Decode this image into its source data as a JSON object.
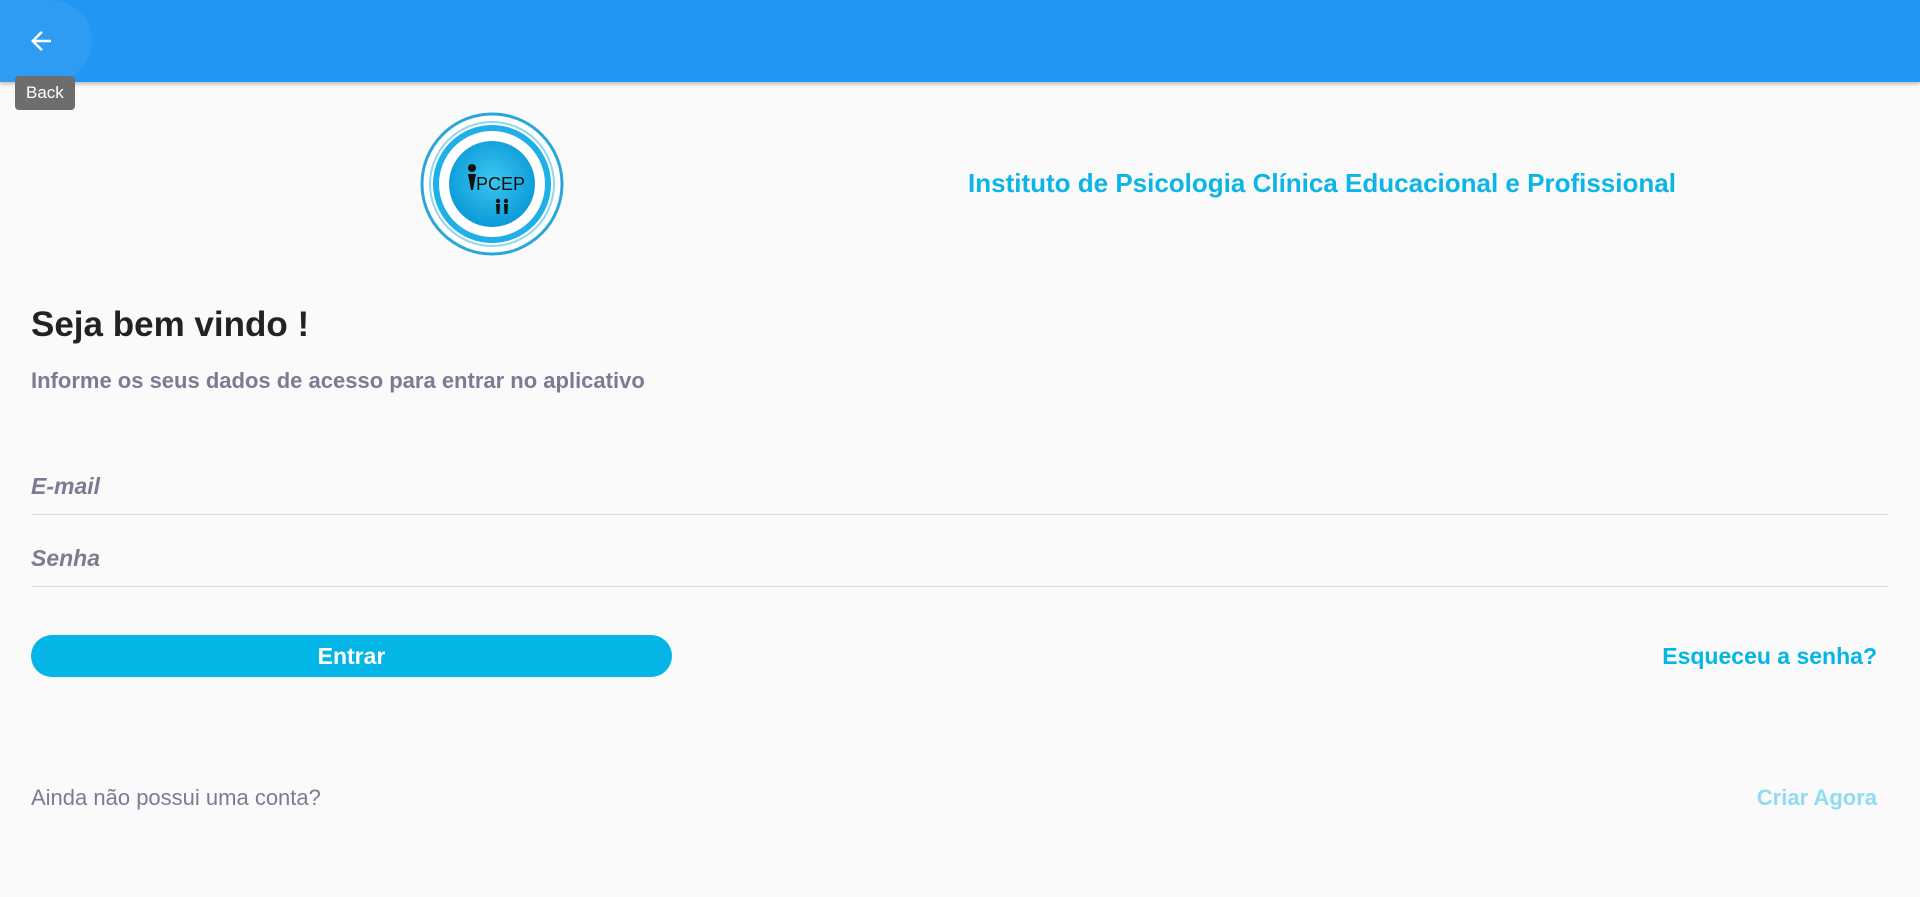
{
  "appbar": {
    "color": "#2196f3",
    "back_icon": "arrow-back-icon",
    "back_tooltip": "Back"
  },
  "header": {
    "logo_text": "PCEP",
    "logo_icon": "pcep-logo",
    "institute_name": "Instituto de Psicologia Clínica Educacional e Profissional",
    "accent_color": "#0bb5e6"
  },
  "login": {
    "welcome_title": "Seja bem vindo !",
    "subtitle": "Informe os seus dados de acesso para entrar no aplicativo",
    "email_placeholder": "E-mail",
    "password_placeholder": "Senha",
    "submit_label": "Entrar",
    "forgot_password": "Esqueceu a senha?",
    "no_account_text": "Ainda não possui uma conta?",
    "create_account": "Criar Agora",
    "button_color": "#04b6e6"
  }
}
